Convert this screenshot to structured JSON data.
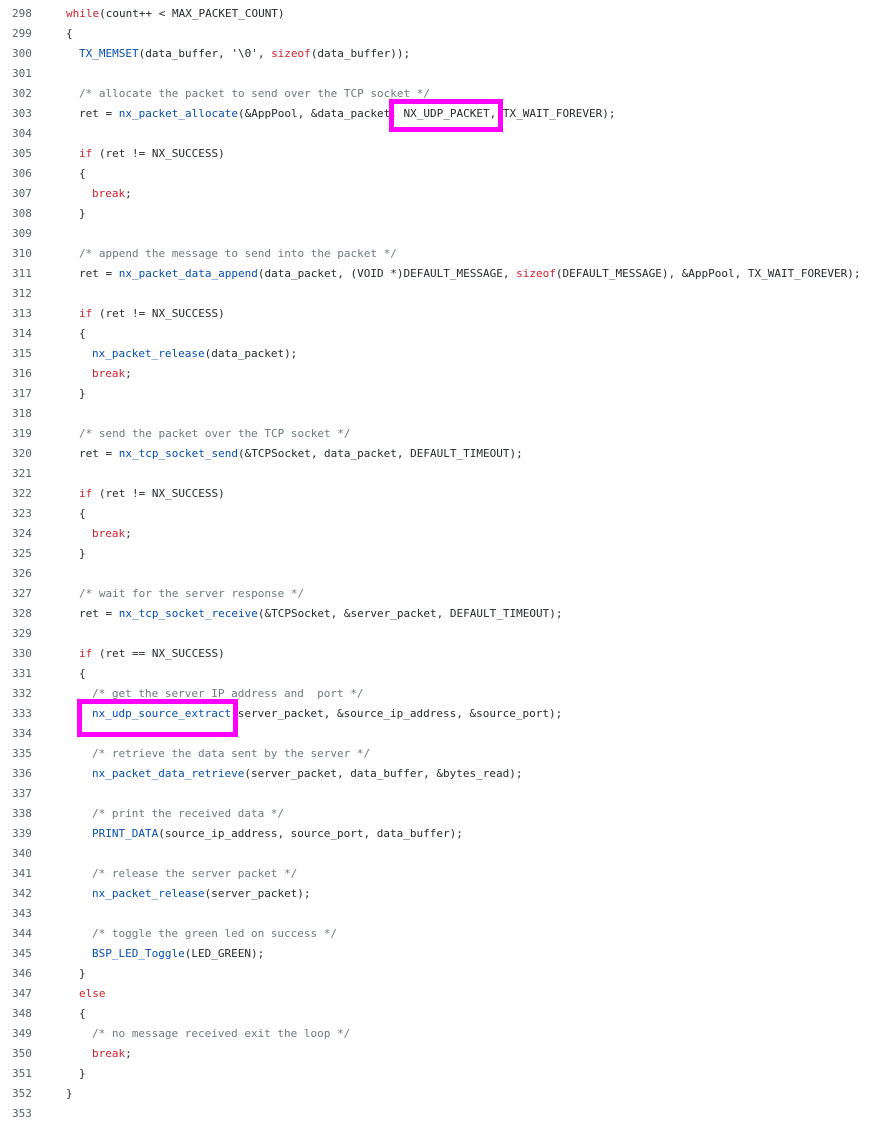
{
  "colors": {
    "function": "#0550ae",
    "keyword": "#cf222e",
    "comment": "#6e7781",
    "plain": "#24292f",
    "line_number": "#57606a",
    "highlight": "#ff00ff"
  },
  "code_lines": [
    {
      "number": "298",
      "indent": 0,
      "tokens": [
        {
          "t": "kw",
          "v": "while"
        },
        {
          "t": "pl",
          "v": "(count++ < MAX_PACKET_COUNT)"
        }
      ]
    },
    {
      "number": "299",
      "indent": 0,
      "tokens": [
        {
          "t": "pl",
          "v": "{"
        }
      ]
    },
    {
      "number": "300",
      "indent": 1,
      "tokens": [
        {
          "t": "fn",
          "v": "TX_MEMSET"
        },
        {
          "t": "pl",
          "v": "(data_buffer, '\\0', "
        },
        {
          "t": "kw",
          "v": "sizeof"
        },
        {
          "t": "pl",
          "v": "(data_buffer));"
        }
      ]
    },
    {
      "number": "301",
      "indent": 0,
      "tokens": []
    },
    {
      "number": "302",
      "indent": 1,
      "tokens": [
        {
          "t": "cm",
          "v": "/* allocate the packet to send over the TCP socket */"
        }
      ]
    },
    {
      "number": "303",
      "indent": 1,
      "tokens": [
        {
          "t": "pl",
          "v": "ret = "
        },
        {
          "t": "fn",
          "v": "nx_packet_allocate"
        },
        {
          "t": "pl",
          "v": "(&AppPool, &data_packet, NX_UDP_PACKET, TX_WAIT_FOREVER);"
        }
      ]
    },
    {
      "number": "304",
      "indent": 0,
      "tokens": []
    },
    {
      "number": "305",
      "indent": 1,
      "tokens": [
        {
          "t": "kw",
          "v": "if"
        },
        {
          "t": "pl",
          "v": " (ret != NX_SUCCESS)"
        }
      ]
    },
    {
      "number": "306",
      "indent": 1,
      "tokens": [
        {
          "t": "pl",
          "v": "{"
        }
      ]
    },
    {
      "number": "307",
      "indent": 2,
      "tokens": [
        {
          "t": "kw",
          "v": "break"
        },
        {
          "t": "pl",
          "v": ";"
        }
      ]
    },
    {
      "number": "308",
      "indent": 1,
      "tokens": [
        {
          "t": "pl",
          "v": "}"
        }
      ]
    },
    {
      "number": "309",
      "indent": 0,
      "tokens": []
    },
    {
      "number": "310",
      "indent": 1,
      "tokens": [
        {
          "t": "cm",
          "v": "/* append the message to send into the packet */"
        }
      ]
    },
    {
      "number": "311",
      "indent": 1,
      "tokens": [
        {
          "t": "pl",
          "v": "ret = "
        },
        {
          "t": "fn",
          "v": "nx_packet_data_append"
        },
        {
          "t": "pl",
          "v": "(data_packet, (VOID *)DEFAULT_MESSAGE, "
        },
        {
          "t": "kw",
          "v": "sizeof"
        },
        {
          "t": "pl",
          "v": "(DEFAULT_MESSAGE), &AppPool, TX_WAIT_FOREVER);"
        }
      ]
    },
    {
      "number": "312",
      "indent": 0,
      "tokens": []
    },
    {
      "number": "313",
      "indent": 1,
      "tokens": [
        {
          "t": "kw",
          "v": "if"
        },
        {
          "t": "pl",
          "v": " (ret != NX_SUCCESS)"
        }
      ]
    },
    {
      "number": "314",
      "indent": 1,
      "tokens": [
        {
          "t": "pl",
          "v": "{"
        }
      ]
    },
    {
      "number": "315",
      "indent": 2,
      "tokens": [
        {
          "t": "fn",
          "v": "nx_packet_release"
        },
        {
          "t": "pl",
          "v": "(data_packet);"
        }
      ]
    },
    {
      "number": "316",
      "indent": 2,
      "tokens": [
        {
          "t": "kw",
          "v": "break"
        },
        {
          "t": "pl",
          "v": ";"
        }
      ]
    },
    {
      "number": "317",
      "indent": 1,
      "tokens": [
        {
          "t": "pl",
          "v": "}"
        }
      ]
    },
    {
      "number": "318",
      "indent": 0,
      "tokens": []
    },
    {
      "number": "319",
      "indent": 1,
      "tokens": [
        {
          "t": "cm",
          "v": "/* send the packet over the TCP socket */"
        }
      ]
    },
    {
      "number": "320",
      "indent": 1,
      "tokens": [
        {
          "t": "pl",
          "v": "ret = "
        },
        {
          "t": "fn",
          "v": "nx_tcp_socket_send"
        },
        {
          "t": "pl",
          "v": "(&TCPSocket, data_packet, DEFAULT_TIMEOUT);"
        }
      ]
    },
    {
      "number": "321",
      "indent": 0,
      "tokens": []
    },
    {
      "number": "322",
      "indent": 1,
      "tokens": [
        {
          "t": "kw",
          "v": "if"
        },
        {
          "t": "pl",
          "v": " (ret != NX_SUCCESS)"
        }
      ]
    },
    {
      "number": "323",
      "indent": 1,
      "tokens": [
        {
          "t": "pl",
          "v": "{"
        }
      ]
    },
    {
      "number": "324",
      "indent": 2,
      "tokens": [
        {
          "t": "kw",
          "v": "break"
        },
        {
          "t": "pl",
          "v": ";"
        }
      ]
    },
    {
      "number": "325",
      "indent": 1,
      "tokens": [
        {
          "t": "pl",
          "v": "}"
        }
      ]
    },
    {
      "number": "326",
      "indent": 0,
      "tokens": []
    },
    {
      "number": "327",
      "indent": 1,
      "tokens": [
        {
          "t": "cm",
          "v": "/* wait for the server response */"
        }
      ]
    },
    {
      "number": "328",
      "indent": 1,
      "tokens": [
        {
          "t": "pl",
          "v": "ret = "
        },
        {
          "t": "fn",
          "v": "nx_tcp_socket_receive"
        },
        {
          "t": "pl",
          "v": "(&TCPSocket, &server_packet, DEFAULT_TIMEOUT);"
        }
      ]
    },
    {
      "number": "329",
      "indent": 0,
      "tokens": []
    },
    {
      "number": "330",
      "indent": 1,
      "tokens": [
        {
          "t": "kw",
          "v": "if"
        },
        {
          "t": "pl",
          "v": " (ret == NX_SUCCESS)"
        }
      ]
    },
    {
      "number": "331",
      "indent": 1,
      "tokens": [
        {
          "t": "pl",
          "v": "{"
        }
      ]
    },
    {
      "number": "332",
      "indent": 2,
      "tokens": [
        {
          "t": "cm",
          "v": "/* get the server IP address and  port */"
        }
      ]
    },
    {
      "number": "333",
      "indent": 2,
      "tokens": [
        {
          "t": "fn",
          "v": "nx_udp_source_extract"
        },
        {
          "t": "pl",
          "v": "(server_packet, &source_ip_address, &source_port);"
        }
      ]
    },
    {
      "number": "334",
      "indent": 0,
      "tokens": []
    },
    {
      "number": "335",
      "indent": 2,
      "tokens": [
        {
          "t": "cm",
          "v": "/* retrieve the data sent by the server */"
        }
      ]
    },
    {
      "number": "336",
      "indent": 2,
      "tokens": [
        {
          "t": "fn",
          "v": "nx_packet_data_retrieve"
        },
        {
          "t": "pl",
          "v": "(server_packet, data_buffer, &bytes_read);"
        }
      ]
    },
    {
      "number": "337",
      "indent": 0,
      "tokens": []
    },
    {
      "number": "338",
      "indent": 2,
      "tokens": [
        {
          "t": "cm",
          "v": "/* print the received data */"
        }
      ]
    },
    {
      "number": "339",
      "indent": 2,
      "tokens": [
        {
          "t": "fn",
          "v": "PRINT_DATA"
        },
        {
          "t": "pl",
          "v": "(source_ip_address, source_port, data_buffer);"
        }
      ]
    },
    {
      "number": "340",
      "indent": 0,
      "tokens": []
    },
    {
      "number": "341",
      "indent": 2,
      "tokens": [
        {
          "t": "cm",
          "v": "/* release the server packet */"
        }
      ]
    },
    {
      "number": "342",
      "indent": 2,
      "tokens": [
        {
          "t": "fn",
          "v": "nx_packet_release"
        },
        {
          "t": "pl",
          "v": "(server_packet);"
        }
      ]
    },
    {
      "number": "343",
      "indent": 0,
      "tokens": []
    },
    {
      "number": "344",
      "indent": 2,
      "tokens": [
        {
          "t": "cm",
          "v": "/* toggle the green led on success */"
        }
      ]
    },
    {
      "number": "345",
      "indent": 2,
      "tokens": [
        {
          "t": "fn",
          "v": "BSP_LED_Toggle"
        },
        {
          "t": "pl",
          "v": "(LED_GREEN);"
        }
      ]
    },
    {
      "number": "346",
      "indent": 1,
      "tokens": [
        {
          "t": "pl",
          "v": "}"
        }
      ]
    },
    {
      "number": "347",
      "indent": 1,
      "tokens": [
        {
          "t": "kw",
          "v": "else"
        }
      ]
    },
    {
      "number": "348",
      "indent": 1,
      "tokens": [
        {
          "t": "pl",
          "v": "{"
        }
      ]
    },
    {
      "number": "349",
      "indent": 2,
      "tokens": [
        {
          "t": "cm",
          "v": "/* no message received exit the loop */"
        }
      ]
    },
    {
      "number": "350",
      "indent": 2,
      "tokens": [
        {
          "t": "kw",
          "v": "break"
        },
        {
          "t": "pl",
          "v": ";"
        }
      ]
    },
    {
      "number": "351",
      "indent": 1,
      "tokens": [
        {
          "t": "pl",
          "v": "}"
        }
      ]
    },
    {
      "number": "352",
      "indent": 0,
      "tokens": [
        {
          "t": "pl",
          "v": "}"
        }
      ]
    },
    {
      "number": "353",
      "indent": 0,
      "tokens": []
    }
  ],
  "highlights": [
    {
      "name": "highlight-nx-udp-packet",
      "line": "303"
    },
    {
      "name": "highlight-nx-udp-source-extract",
      "line": "333"
    }
  ]
}
